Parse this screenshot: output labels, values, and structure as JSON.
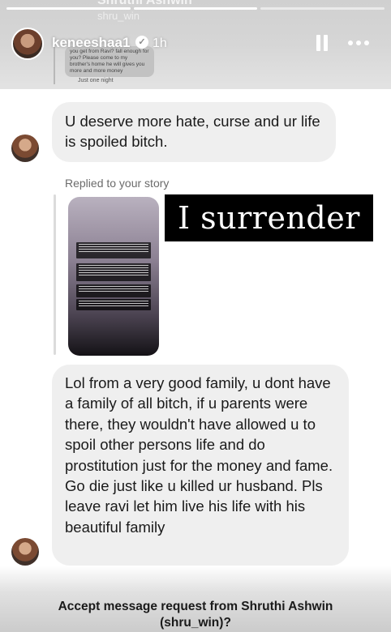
{
  "header": {
    "ghost_name": "Shruthi Ashwin",
    "ghost_handle": "shru_win",
    "username": "keneeshaa1",
    "time": "1h",
    "colors": {
      "accent": "#ffffff"
    }
  },
  "quoted_message": {
    "text": "you get from Ravi? fall enough for you? Please come to my brother's home he will gives you more and more money",
    "note": "Just one night"
  },
  "messages": {
    "first": "U deserve more hate, curse and ur life is spoiled bitch.",
    "replied_label": "Replied to your story",
    "story_caption": "I surrender",
    "second": "Lol from a very good family, u dont have a family of all bitch, if u parents were there, they wouldn't have allowed u to spoil other persons life and do prostitution just for the money and fame. Go die just like u killed ur husband. Pls leave ravi let him live his life with his beautiful family"
  },
  "footer": {
    "line1": "Accept message request from Shruthi Ashwin",
    "line2": "(shru_win)?"
  },
  "icons": [
    "verified-icon",
    "pause-icon",
    "more-icon"
  ]
}
